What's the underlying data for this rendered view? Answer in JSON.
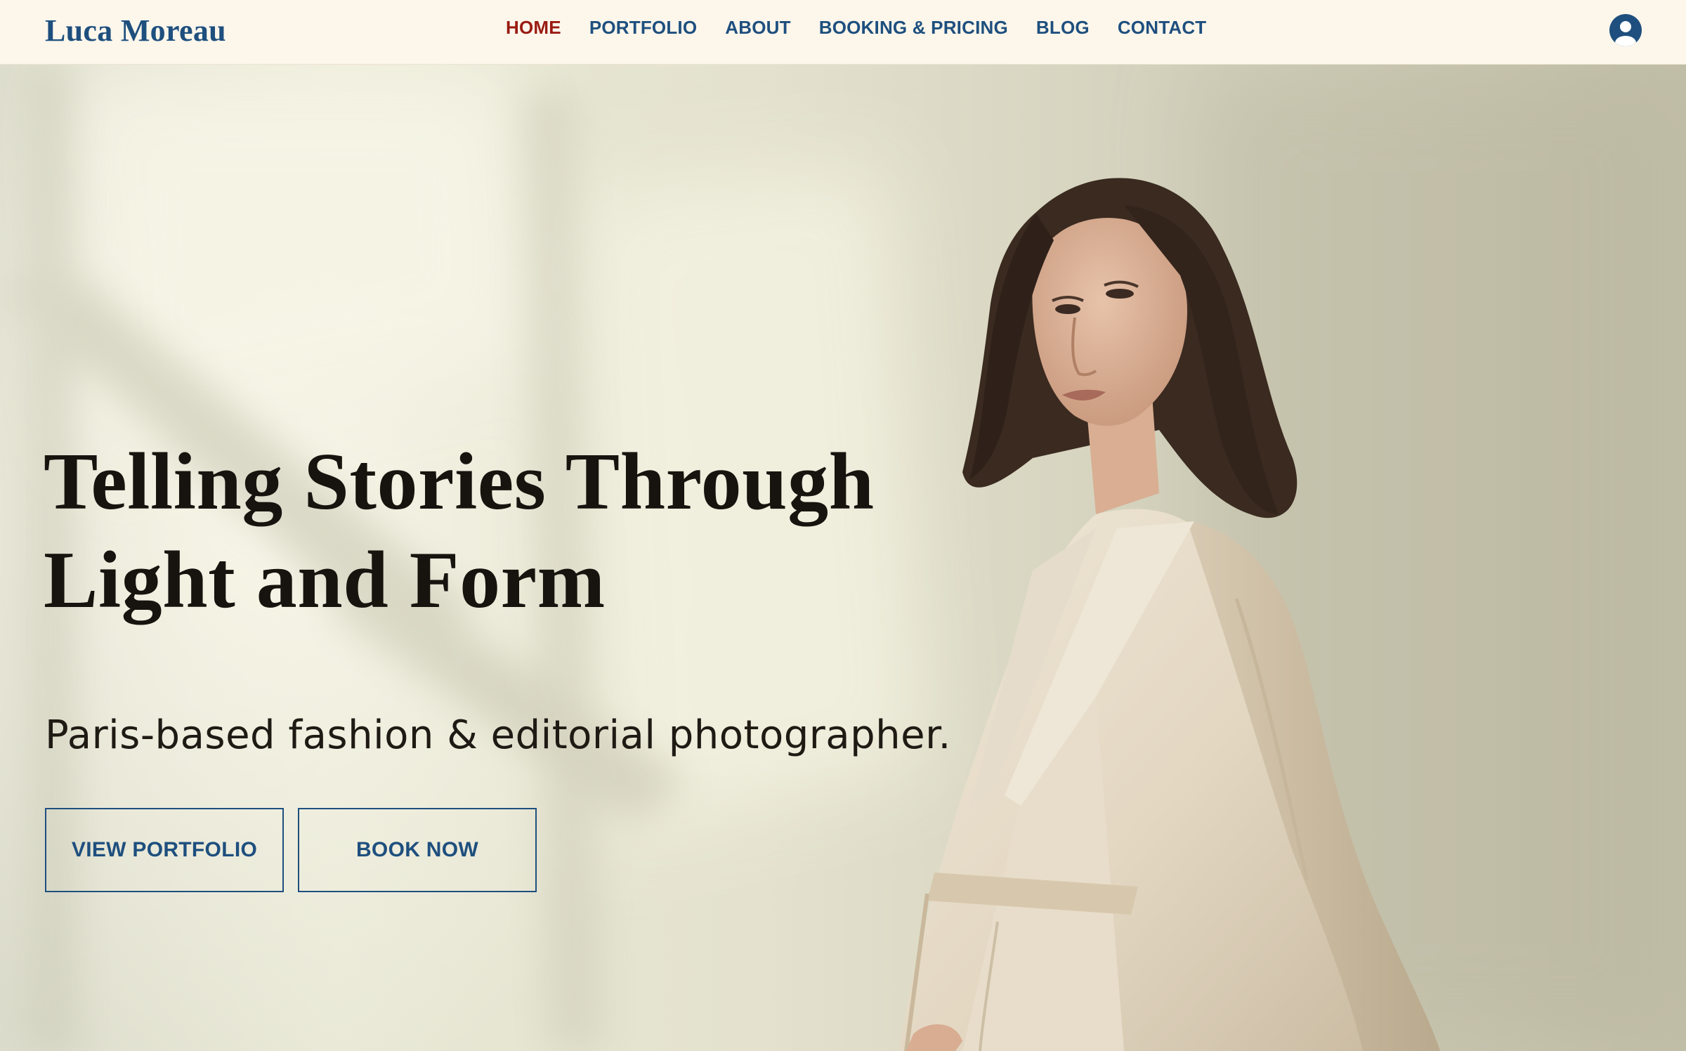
{
  "brand": {
    "name": "Luca Moreau"
  },
  "nav": {
    "items": [
      {
        "label": "HOME",
        "active": true
      },
      {
        "label": "PORTFOLIO",
        "active": false
      },
      {
        "label": "ABOUT",
        "active": false
      },
      {
        "label": "BOOKING & PRICING",
        "active": false
      },
      {
        "label": "BLOG",
        "active": false
      },
      {
        "label": "CONTACT",
        "active": false
      }
    ],
    "account_icon": "user-circle-icon"
  },
  "hero": {
    "headline_line1": "Telling Stories Through",
    "headline_line2": "Light and Form",
    "subheadline": "Paris-based fashion & editorial photographer.",
    "primary_cta": "VIEW PORTFOLIO",
    "secondary_cta": "BOOK NOW",
    "image_subject": "woman-in-beige-trench-coat-photo"
  },
  "colors": {
    "brand_blue": "#1e4f7e",
    "active_nav": "#9a1b12",
    "header_bg": "#fcf6eb",
    "headline_text": "#17130e"
  }
}
